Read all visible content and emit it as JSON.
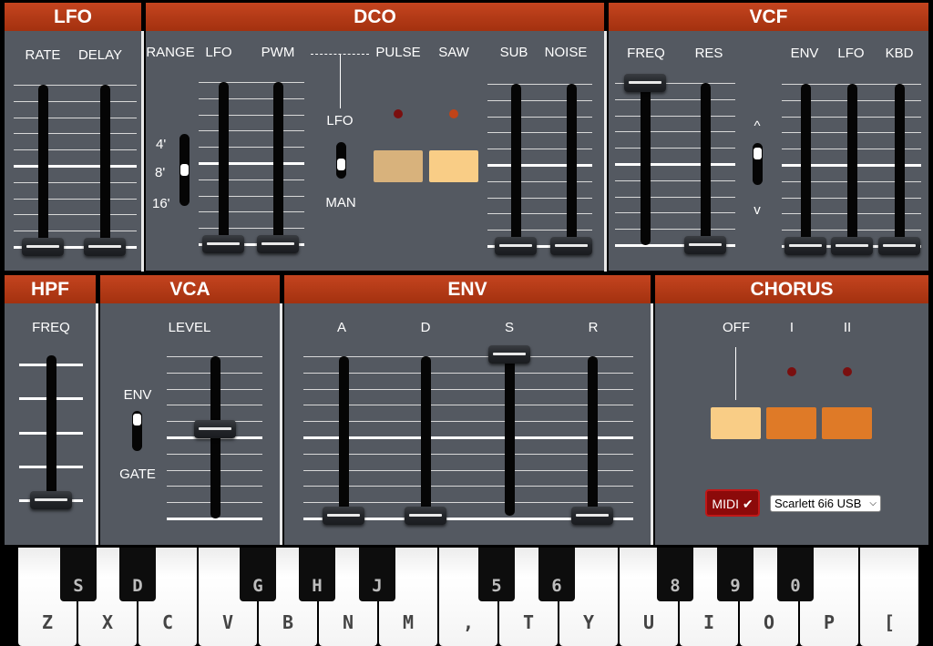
{
  "sections": {
    "lfo": "LFO",
    "dco": "DCO",
    "vcf": "VCF",
    "hpf": "HPF",
    "vca": "VCA",
    "env": "ENV",
    "chorus": "CHORUS"
  },
  "lfo": {
    "rate_label": "RATE",
    "delay_label": "DELAY",
    "rate_value": 0.0,
    "delay_value": 0.0
  },
  "dco": {
    "range_label": "RANGE",
    "range_options": [
      "4'",
      "8'",
      "16'"
    ],
    "range_selected": "8'",
    "lfo_label": "LFO",
    "pwm_label": "PWM",
    "lfo_value": 0.0,
    "pwm_value": 0.0,
    "pwm_source_lfo": "LFO",
    "pwm_source_man": "MAN",
    "pulse_label": "PULSE",
    "saw_label": "SAW",
    "sub_label": "SUB",
    "noise_label": "NOISE",
    "sub_value": 0.0,
    "noise_value": 0.0
  },
  "vcf": {
    "freq_label": "FREQ",
    "res_label": "RES",
    "freq_value": 1.0,
    "res_value": 0.0,
    "polarity_up": "^",
    "polarity_down": "v",
    "env_label": "ENV",
    "lfo_label": "LFO",
    "kbd_label": "KBD",
    "env_value": 0.0,
    "lfo_value": 0.0,
    "kbd_value": 0.0
  },
  "hpf": {
    "freq_label": "FREQ",
    "freq_value": 0.0
  },
  "vca": {
    "env_label": "ENV",
    "gate_label": "GATE",
    "level_label": "LEVEL",
    "level_value": 0.55
  },
  "env": {
    "a_label": "A",
    "d_label": "D",
    "s_label": "S",
    "r_label": "R",
    "a_value": 0.0,
    "d_value": 0.0,
    "s_value": 1.0,
    "r_value": 0.0
  },
  "chorus": {
    "off_label": "OFF",
    "i_label": "I",
    "ii_label": "II"
  },
  "midi": {
    "label": "MIDI",
    "check_icon": "✔",
    "device": "Scarlett 6i6 USB",
    "dropdown_icon": "⌵"
  },
  "keyboard": {
    "white_keys": [
      "Z",
      "X",
      "C",
      "V",
      "B",
      "N",
      "M",
      ",",
      "T",
      "Y",
      "U",
      "I",
      "O",
      "P",
      "["
    ],
    "black_keys": [
      "S",
      "D",
      "G",
      "H",
      "J",
      "5",
      "6",
      "8",
      "9",
      "0"
    ]
  },
  "colors": {
    "panel": "#545961",
    "header": "#b83b17",
    "led_on": "#c04419",
    "led_off": "#7a0f0f",
    "button_light": "#f9cd86",
    "button_dim": "#d8b27c",
    "button_orange": "#df7a27"
  }
}
